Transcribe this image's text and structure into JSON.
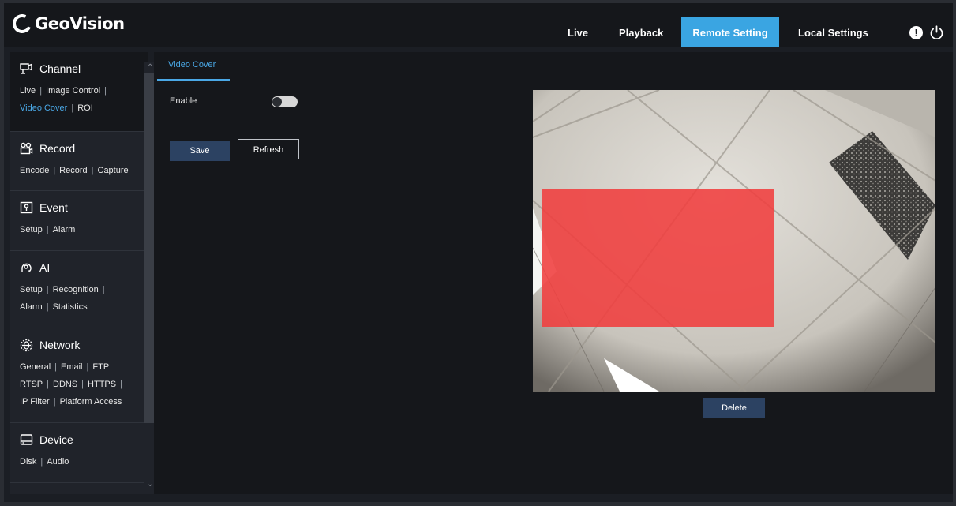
{
  "app": {
    "logo_text": "GeoVision"
  },
  "nav": {
    "live": "Live",
    "playback": "Playback",
    "remote_setting": "Remote Setting",
    "local_settings": "Local Settings",
    "info_glyph": "!"
  },
  "sidebar": {
    "channel": {
      "title": "Channel",
      "links": [
        "Live",
        "Image Control",
        "Video Cover",
        "ROI"
      ]
    },
    "record": {
      "title": "Record",
      "links": [
        "Encode",
        "Record",
        "Capture"
      ]
    },
    "event": {
      "title": "Event",
      "links": [
        "Setup",
        "Alarm"
      ]
    },
    "ai": {
      "title": "AI",
      "links": [
        "Setup",
        "Recognition",
        "Alarm",
        "Statistics"
      ]
    },
    "network": {
      "title": "Network",
      "links": [
        "General",
        "Email",
        "FTP",
        "RTSP",
        "DDNS",
        "HTTPS",
        "IP Filter",
        "Platform Access"
      ]
    },
    "device": {
      "title": "Device",
      "links": [
        "Disk",
        "Audio"
      ]
    }
  },
  "main": {
    "tab": "Video Cover",
    "enable_label": "Enable",
    "enable_state": false,
    "save": "Save",
    "refresh": "Refresh",
    "delete": "Delete"
  },
  "colors": {
    "accent": "#3aa5e2",
    "cover": "#f03e3e"
  }
}
